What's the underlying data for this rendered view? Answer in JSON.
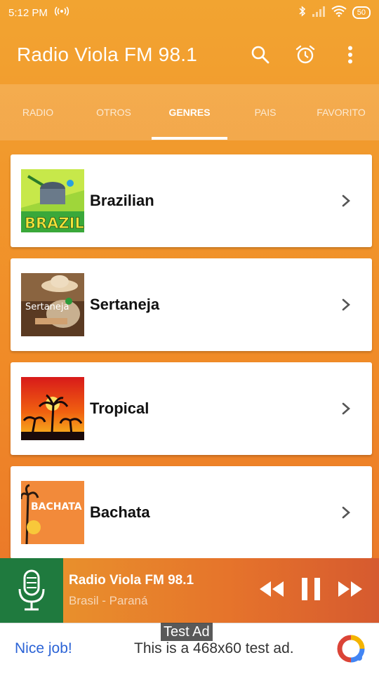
{
  "status_bar": {
    "time": "5:12 PM",
    "battery": "50",
    "icons": [
      "hotspot-icon",
      "bluetooth-icon",
      "signal-icon",
      "wifi-icon",
      "battery-icon"
    ]
  },
  "app_bar": {
    "title": "Radio Viola FM 98.1",
    "actions": [
      "search-icon",
      "alarm-icon",
      "more-vert-icon"
    ]
  },
  "tabs": [
    {
      "label": "RADIO",
      "active": false
    },
    {
      "label": "OTROS",
      "active": false
    },
    {
      "label": "GENRES",
      "active": true
    },
    {
      "label": "PAIS",
      "active": false
    },
    {
      "label": "FAVORITO",
      "active": false
    }
  ],
  "genres": [
    {
      "name": "Brazilian",
      "thumb_text": "BRAZIL"
    },
    {
      "name": "Sertaneja",
      "thumb_text": "Sertaneja"
    },
    {
      "name": "Tropical",
      "thumb_text": ""
    },
    {
      "name": "Bachata",
      "thumb_text": "BACHATA"
    }
  ],
  "player": {
    "title": "Radio Viola FM 98.1",
    "subtitle": "Brasil - Paraná"
  },
  "ad": {
    "label": "Test Ad",
    "cta": "Nice job!",
    "text": "This is a 468x60 test ad."
  },
  "colors": {
    "accent": "#f08a27",
    "mic_background": "#1f7a3e",
    "ad_link": "#2b63d6"
  }
}
